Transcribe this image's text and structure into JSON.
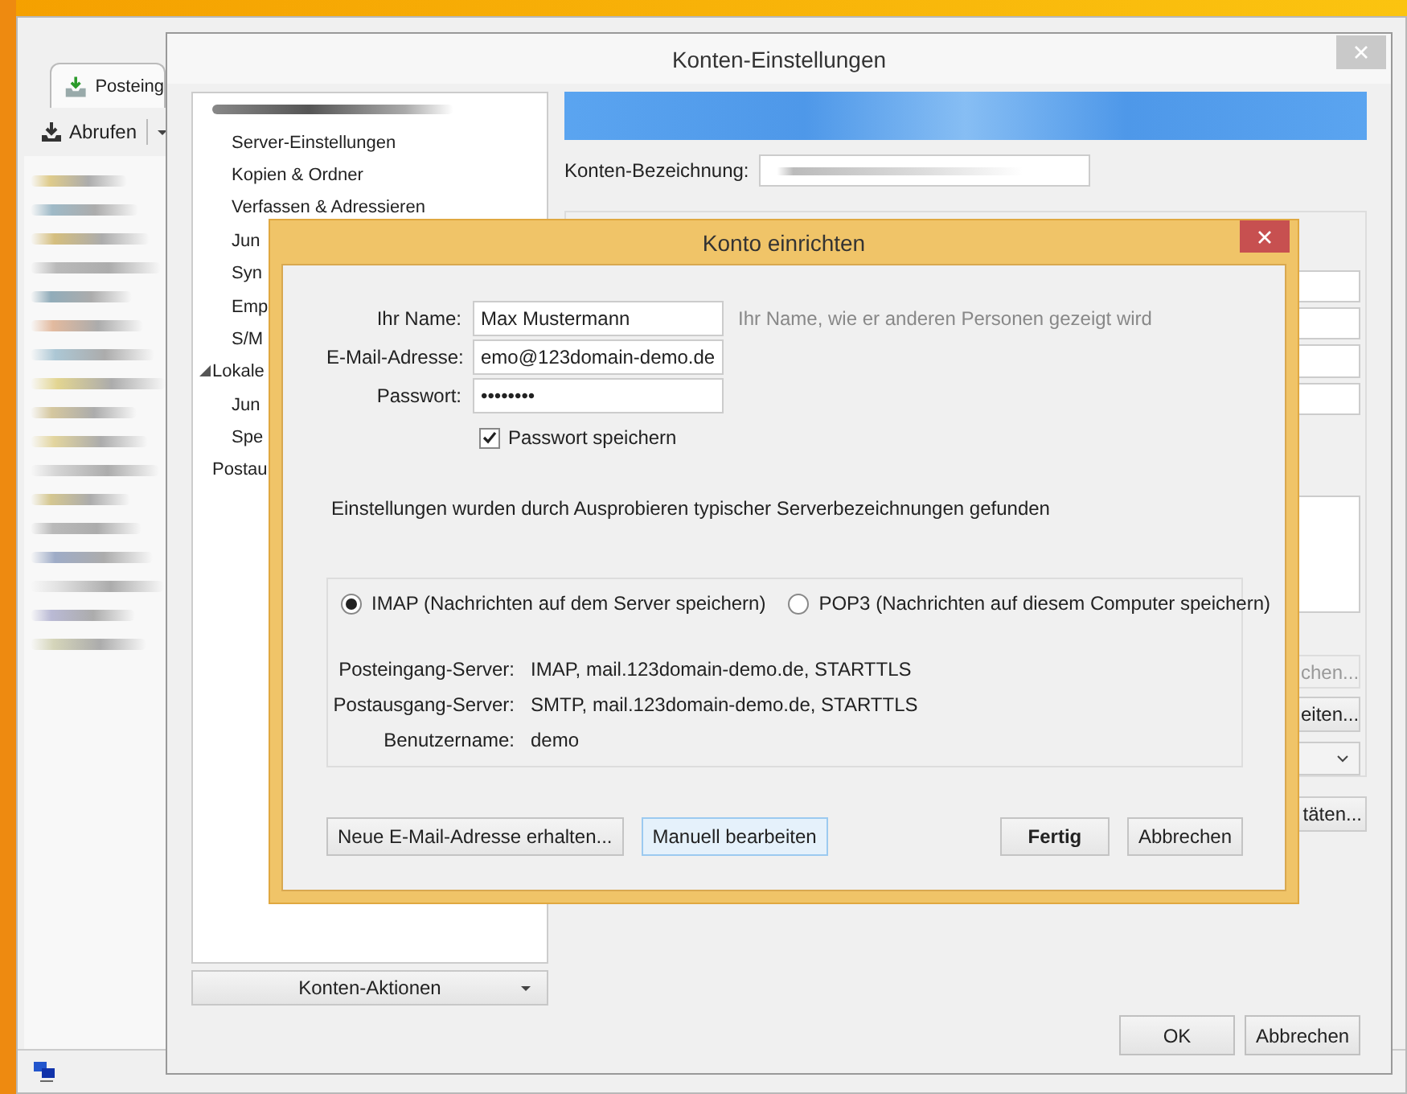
{
  "main_window": {
    "tab": {
      "label": "Posteing",
      "selected": true
    },
    "toolbar": {
      "get_messages": "Abrufen"
    }
  },
  "account_settings": {
    "title": "Konten-Einstellungen",
    "tree": [
      {
        "kind": "blurred",
        "children": [
          {
            "label": "Server-Einstellungen"
          },
          {
            "label": "Kopien & Ordner"
          },
          {
            "label": "Verfassen & Adressieren"
          },
          {
            "label": "Jun"
          },
          {
            "label": "Syn"
          },
          {
            "label": "Emp"
          },
          {
            "label": "S/M"
          }
        ]
      },
      {
        "kind": "label",
        "label": "Lokale",
        "expanded": true,
        "children": [
          {
            "label": "Jun"
          },
          {
            "label": "Spe"
          }
        ]
      },
      {
        "kind": "label",
        "label": "Postau"
      }
    ],
    "actions_button": "Konten-Aktionen",
    "account_name_label": "Konten-Bezeichnung:",
    "side_buttons": [
      {
        "label": "chen...",
        "disabled": true
      },
      {
        "label": "eiten...",
        "disabled": false
      }
    ],
    "identities_button": "täten...",
    "ok": "OK",
    "cancel": "Abbrechen"
  },
  "setup_dialog": {
    "title": "Konto einrichten",
    "fields": [
      {
        "label": "Ihr Name:",
        "value": "Max Mustermann",
        "hint": "Ihr Name, wie er anderen Personen gezeigt wird"
      },
      {
        "label": "E-Mail-Adresse:",
        "value": "emo@123domain-demo.de"
      },
      {
        "label": "Passwort:",
        "value": "••••••••"
      }
    ],
    "save_password": {
      "label": "Passwort speichern",
      "checked": true
    },
    "message": "Einstellungen wurden durch Ausprobieren typischer Serverbezeichnungen gefunden",
    "protocols": [
      {
        "label": "IMAP (Nachrichten auf dem Server speichern)",
        "selected": true
      },
      {
        "label": "POP3 (Nachrichten auf diesem Computer speichern)",
        "selected": false
      }
    ],
    "servers": [
      {
        "label": "Posteingang-Server:",
        "value": "IMAP, mail.123domain-demo.de, STARTTLS"
      },
      {
        "label": "Postausgang-Server:",
        "value": "SMTP, mail.123domain-demo.de, STARTTLS"
      },
      {
        "label": "Benutzername:",
        "value": "demo"
      }
    ],
    "left_buttons": [
      {
        "label": "Neue E-Mail-Adresse erhalten...",
        "focused": false
      },
      {
        "label": "Manuell bearbeiten",
        "focused": true
      }
    ],
    "right_buttons": [
      {
        "label": "Fertig",
        "default": true
      },
      {
        "label": "Abbrechen",
        "default": false
      }
    ]
  }
}
